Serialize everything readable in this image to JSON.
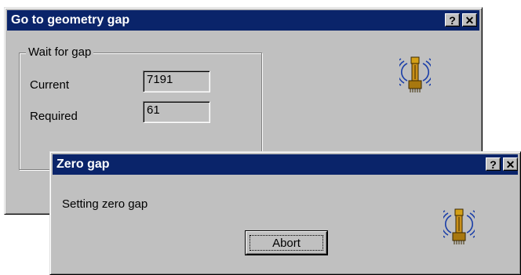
{
  "back_dialog": {
    "title": "Go to geometry gap",
    "help_button": "?",
    "close_button": "✕",
    "group_label": "Wait for gap",
    "current_label": "Current",
    "current_value": "7191",
    "required_label": "Required",
    "required_value": "61",
    "icon": "antenna-icon"
  },
  "front_dialog": {
    "title": "Zero gap",
    "help_button": "?",
    "close_button": "✕",
    "message": "Setting zero gap",
    "abort_button": "Abort",
    "icon": "antenna-icon"
  },
  "colors": {
    "titlebar": "#0a246a",
    "window_face": "#c0c0c0"
  }
}
